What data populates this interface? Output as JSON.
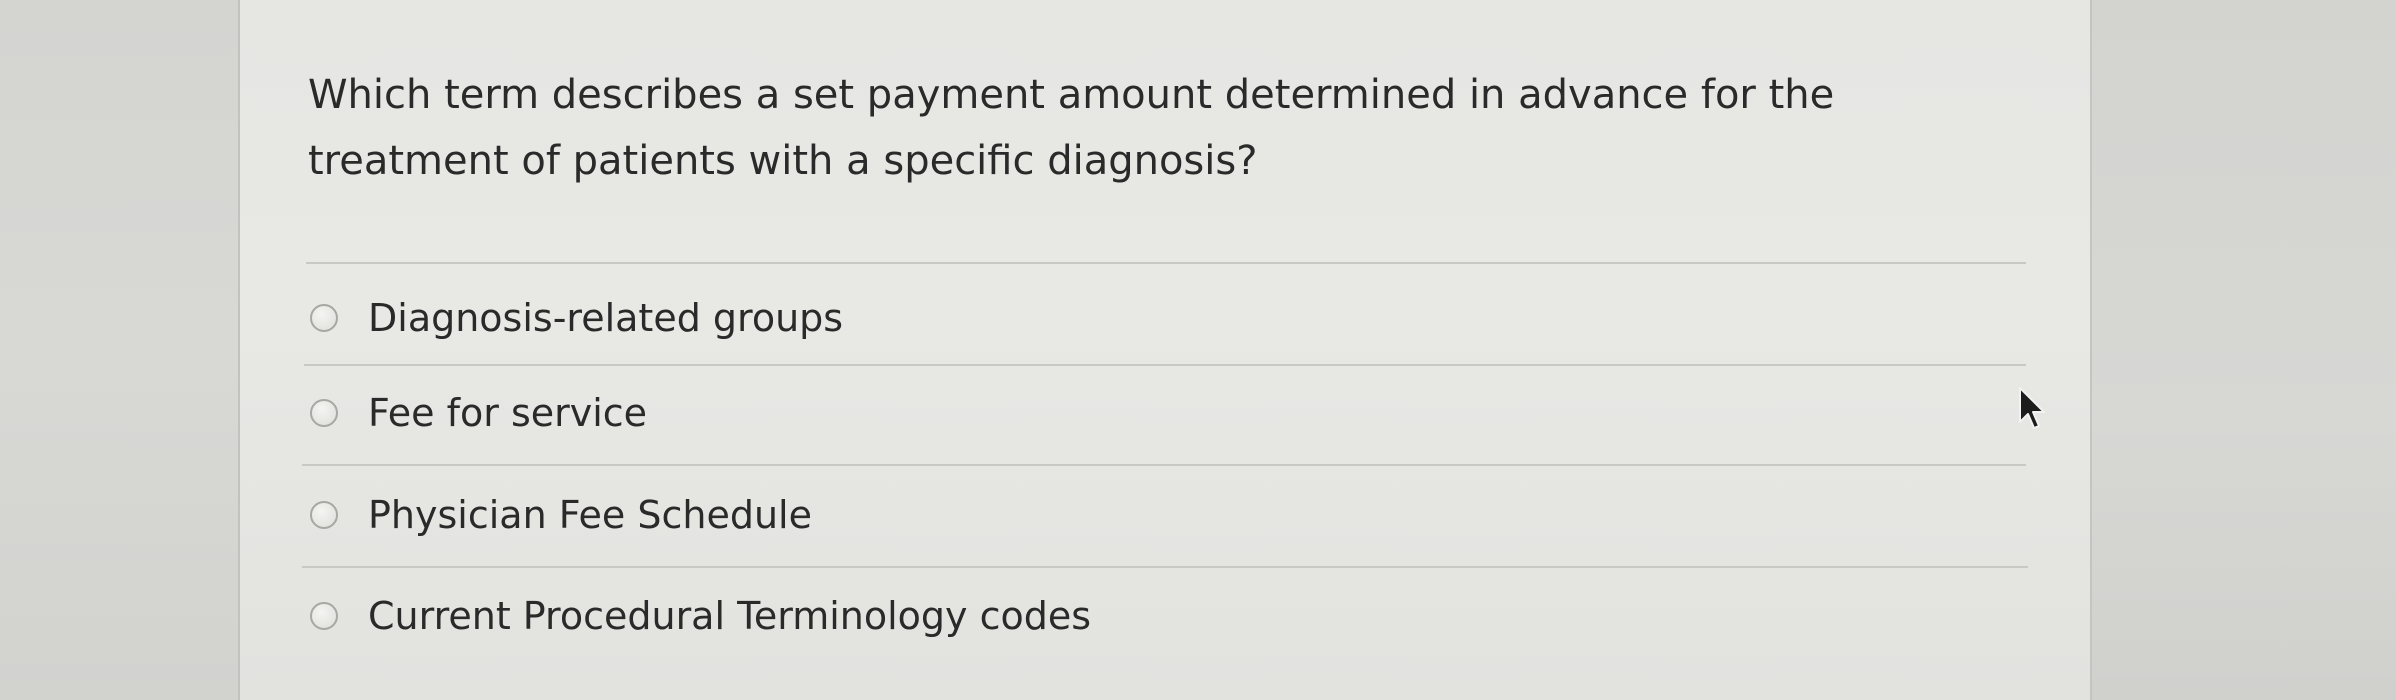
{
  "question": {
    "text": "Which term describes a set payment amount determined in advance for the treatment of patients with a specific diagnosis?"
  },
  "options": [
    {
      "label": "Diagnosis-related groups",
      "selected": false
    },
    {
      "label": "Fee for service",
      "selected": false
    },
    {
      "label": "Physician Fee Schedule",
      "selected": false
    },
    {
      "label": "Current Procedural Terminology codes",
      "selected": false
    }
  ],
  "pointer": {
    "icon": "mouse-pointer-icon"
  }
}
